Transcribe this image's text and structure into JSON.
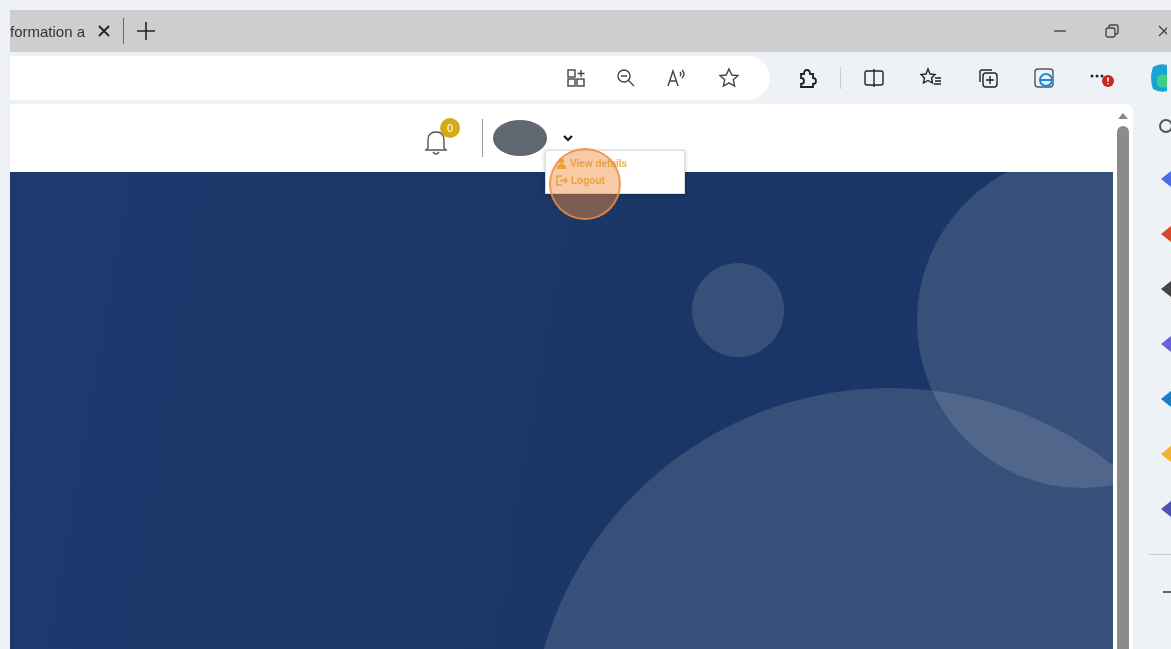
{
  "browser_tab": {
    "title": "formation a"
  },
  "notifications": {
    "count": "0"
  },
  "user_menu": {
    "expanded": true,
    "items": [
      {
        "kind": "profile",
        "label": "View details"
      },
      {
        "kind": "logout",
        "label": "Logout"
      }
    ]
  }
}
